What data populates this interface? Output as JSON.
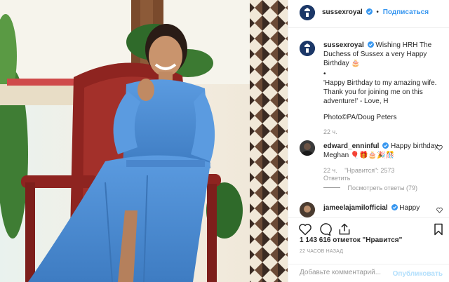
{
  "header": {
    "username": "sussexroyal",
    "separator": "•",
    "follow_label": "Подписаться"
  },
  "caption": {
    "username": "sussexroyal",
    "text_line1": "Wishing HRH The Duchess of Sussex a very Happy Birthday 🎂",
    "bullet": "•",
    "quote": "'Happy Birthday to my amazing wife. Thank you for joining me on this adventure!' - Love, H",
    "credit": "Photo©PA/Doug Peters",
    "time": "22 ч."
  },
  "comments": [
    {
      "username": "edward_enninful",
      "text": "Happy birthday Meghan 🎈🎁🎂🎉🎊",
      "time": "22 ч.",
      "likes": "\"Нравится\": 2573",
      "reply": "Ответить",
      "view_replies": "Посмотреть ответы (79)"
    },
    {
      "username": "jameelajamilofficial",
      "text": "Happy"
    }
  ],
  "stats": {
    "likes": "1 143 616 отметок \"Нравится\"",
    "time_ago": "22 ЧАСОВ НАЗАД"
  },
  "add_comment": {
    "placeholder": "Добавьте комментарий...",
    "publish_label": "Опубликовать"
  },
  "colors": {
    "link": "#3897f0",
    "verified": "#3897f0",
    "muted": "#999999",
    "dress": "#4a8ad0"
  },
  "icons": [
    "verified-icon",
    "heart-icon",
    "comment-icon",
    "share-icon",
    "bookmark-icon"
  ]
}
